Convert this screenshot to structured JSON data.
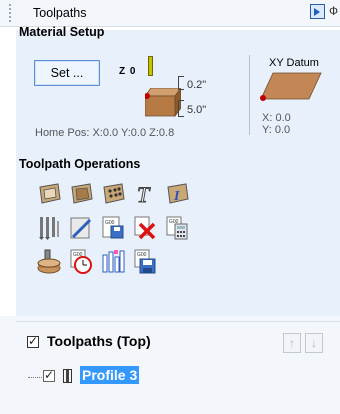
{
  "header": {
    "title": "Toolpaths",
    "pin_icon": "pin-icon"
  },
  "material_setup": {
    "title": "Material Setup",
    "set_button": "Set ...",
    "z0_label": "Z 0",
    "thickness_top": "0.2\"",
    "thickness_bottom": "5.0\"",
    "home_pos": "Home Pos:  X:0.0 Y:0.0 Z:0.8",
    "xy_datum": {
      "title": "XY Datum",
      "x": "X: 0.0",
      "y": "Y: 0.0"
    }
  },
  "toolpath_operations": {
    "title": "Toolpath Operations",
    "icons": [
      "profile-toolpath-icon",
      "pocket-toolpath-icon",
      "drilling-toolpath-icon",
      "quick-engrave-icon",
      "vcarve-inlay-icon",
      "fluting-toolpath-icon",
      "texture-toolpath-icon",
      "save-gcode-icon",
      "delete-toolpath-icon",
      "calculator-icon",
      "simulate-icon",
      "time-estimate-icon",
      "toolpath-templates-icon",
      "save-toolpaths-icon"
    ]
  },
  "toolpaths_list": {
    "title": "Toolpaths (Top)",
    "header_checked": true,
    "items": [
      {
        "label": "Profile 3",
        "checked": true,
        "selected": true
      }
    ]
  },
  "colors": {
    "panel_bg": "#e8f1fb",
    "selection": "#3399ff",
    "button_border": "#5b8fd3"
  }
}
